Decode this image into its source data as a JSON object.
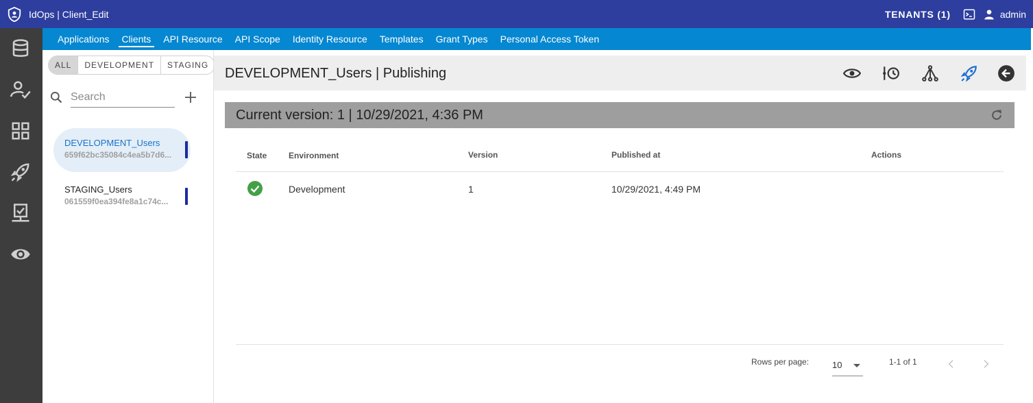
{
  "app": {
    "title": "IdOps | Client_Edit",
    "tenants": "TENANTS (1)",
    "user": "admin"
  },
  "nav": {
    "tabs": [
      "Applications",
      "Clients",
      "API Resource",
      "API Scope",
      "Identity Resource",
      "Templates",
      "Grant Types",
      "Personal Access Token"
    ],
    "active": "Clients"
  },
  "filters": [
    "ALL",
    "DEVELOPMENT",
    "STAGING"
  ],
  "search": {
    "placeholder": "Search"
  },
  "clients": [
    {
      "name": "DEVELOPMENT_Users",
      "id": "659f62bc35084c4ea5b7d6..."
    },
    {
      "name": "STAGING_Users",
      "id": "061559f0ea394fe8a1c74c..."
    }
  ],
  "page": {
    "title": "DEVELOPMENT_Users | Publishing"
  },
  "version": {
    "text": "Current version: 1 | 10/29/2021, 4:36 PM"
  },
  "table": {
    "headers": {
      "state": "State",
      "environment": "Environment",
      "version": "Version",
      "published_at": "Published at",
      "actions": "Actions"
    },
    "rows": [
      {
        "environment": "Development",
        "version": "1",
        "published_at": "10/29/2021, 4:49 PM"
      }
    ]
  },
  "pagination": {
    "rows_per_page_label": "Rows per page:",
    "rows_per_page": "10",
    "range": "1-1 of 1"
  },
  "colors": {
    "topbar": "#2d3e9e",
    "navbar": "#0587d1",
    "rail": "#3d3d3d",
    "success": "#43a047"
  }
}
